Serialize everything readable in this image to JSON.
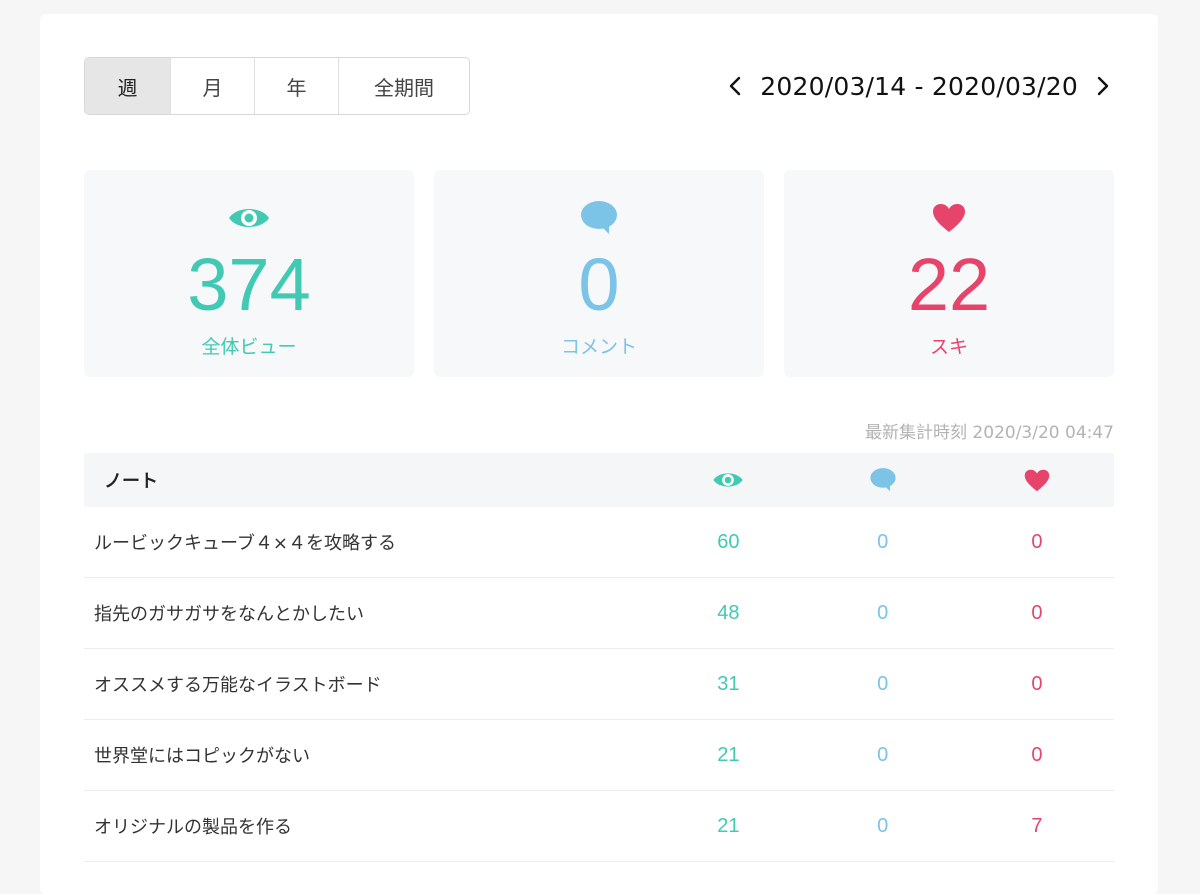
{
  "colors": {
    "views": "#41c9b4",
    "comments": "#7cc3e8",
    "likes": "#e6446a"
  },
  "period_tabs": [
    {
      "label": "週",
      "active": true
    },
    {
      "label": "月",
      "active": false
    },
    {
      "label": "年",
      "active": false
    },
    {
      "label": "全期間",
      "active": false
    }
  ],
  "date_range": {
    "text": "2020/03/14 - 2020/03/20",
    "prev_icon": "chevron-left-icon",
    "next_icon": "chevron-right-icon"
  },
  "stats": [
    {
      "icon": "eye-icon",
      "value": "374",
      "label": "全体ビュー"
    },
    {
      "icon": "comment-icon",
      "value": "0",
      "label": "コメント"
    },
    {
      "icon": "heart-icon",
      "value": "22",
      "label": "スキ"
    }
  ],
  "updated": "最新集計時刻 2020/3/20 04:47",
  "table": {
    "header": {
      "note": "ノート",
      "views_icon": "eye-icon",
      "comments_icon": "comment-icon",
      "likes_icon": "heart-icon"
    },
    "rows": [
      {
        "title": "ルービックキューブ４×４を攻略する",
        "views": "60",
        "comments": "0",
        "likes": "0"
      },
      {
        "title": "指先のガサガサをなんとかしたい",
        "views": "48",
        "comments": "0",
        "likes": "0"
      },
      {
        "title": "オススメする万能なイラストボード",
        "views": "31",
        "comments": "0",
        "likes": "0"
      },
      {
        "title": "世界堂にはコピックがない",
        "views": "21",
        "comments": "0",
        "likes": "0"
      },
      {
        "title": "オリジナルの製品を作る",
        "views": "21",
        "comments": "0",
        "likes": "7"
      }
    ]
  }
}
